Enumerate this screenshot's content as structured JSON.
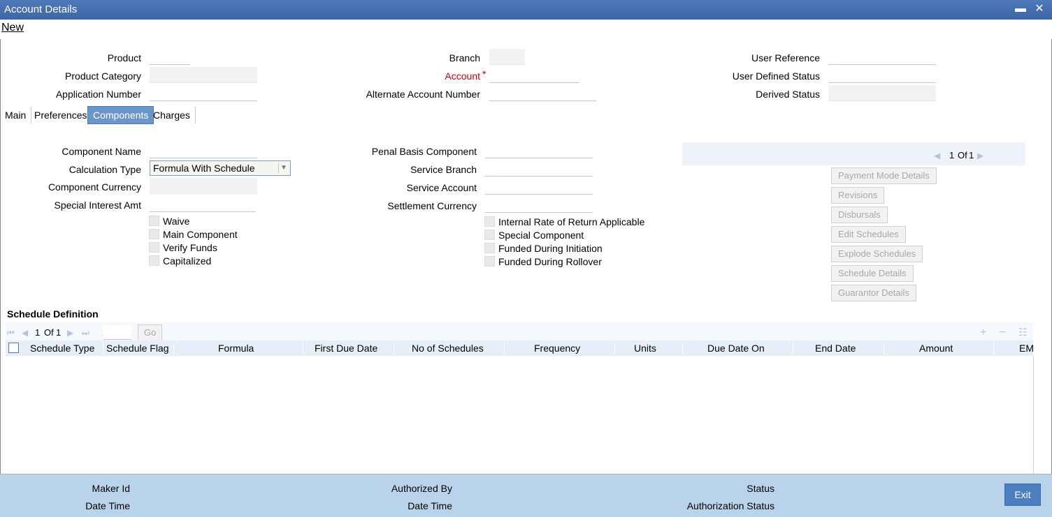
{
  "window": {
    "title": "Account Details",
    "minimize_glyph": "▬",
    "close_glyph": "✕"
  },
  "menu": {
    "new_label": "New"
  },
  "header": {
    "product": "Product",
    "product_category": "Product Category",
    "application_number": "Application Number",
    "branch": "Branch",
    "account": "Account",
    "required_mark": "*",
    "alternate_account_number": "Alternate Account Number",
    "user_reference": "User Reference",
    "user_defined_status": "User Defined Status",
    "derived_status": "Derived Status"
  },
  "tabs": [
    {
      "label": "Main",
      "active": false
    },
    {
      "label": "Preferences",
      "active": false
    },
    {
      "label": "Components",
      "active": true
    },
    {
      "label": "Charges",
      "active": false
    }
  ],
  "components": {
    "component_name": "Component Name",
    "calculation_type": "Calculation Type",
    "calculation_type_value": "Formula With Schedule",
    "component_currency": "Component Currency",
    "special_interest_amt": "Special Interest Amt",
    "penal_basis_component": "Penal Basis Component",
    "service_branch": "Service Branch",
    "service_account": "Service Account",
    "settlement_currency": "Settlement Currency",
    "checks_left": [
      "Waive",
      "Main Component",
      "Verify Funds",
      "Capitalized"
    ],
    "checks_right": [
      "Internal Rate of Return Applicable",
      "Special Component",
      "Funded During Initiation",
      "Funded During Rollover"
    ]
  },
  "side_pager": {
    "current": "1",
    "of_label": "Of",
    "total": "1"
  },
  "side_buttons": [
    "Payment Mode Details",
    "Revisions",
    "Disbursals",
    "Edit Schedules",
    "Explode Schedules",
    "Schedule Details",
    "Guarantor Details"
  ],
  "schedule": {
    "title": "Schedule Definition",
    "pager": {
      "current": "1",
      "of_label": "Of",
      "total": "1",
      "go_label": "Go"
    },
    "columns": [
      "Schedule Type",
      "Schedule Flag",
      "Formula",
      "First Due Date",
      "No of Schedules",
      "Frequency",
      "Units",
      "Due Date On",
      "End Date",
      "Amount",
      "EM"
    ]
  },
  "footer": {
    "maker_id": "Maker Id",
    "date_time_1": "Date Time",
    "authorized_by": "Authorized By",
    "date_time_2": "Date Time",
    "status": "Status",
    "authorization_status": "Authorization Status",
    "exit_label": "Exit"
  },
  "colors": {
    "titlebar": "#3d66a7",
    "active_tab": "#6b96cc",
    "footer": "#b9d3ea",
    "exit_button": "#4b7fbf",
    "required": "#cc0000"
  }
}
